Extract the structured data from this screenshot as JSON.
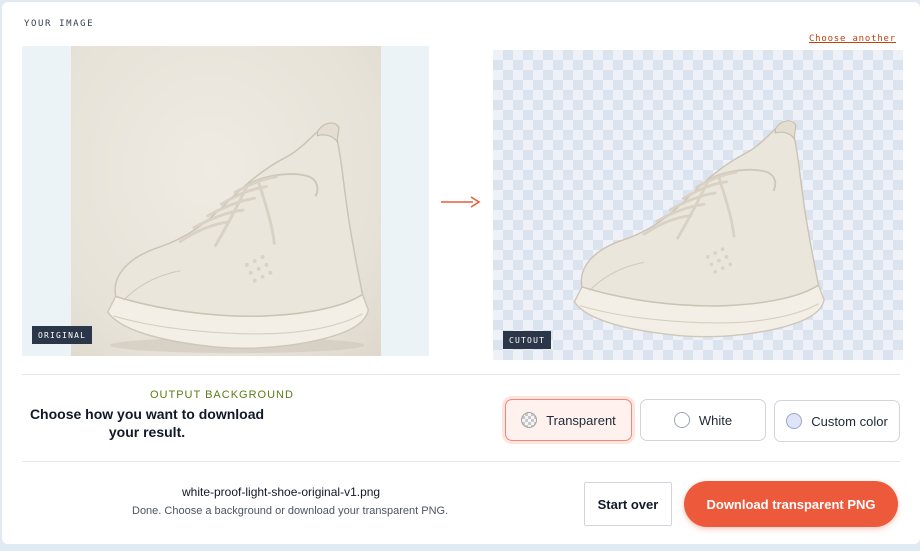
{
  "header": {
    "section_title": "YOUR IMAGE",
    "choose_another": "Choose another"
  },
  "preview": {
    "original_badge": "ORIGINAL",
    "cutout_badge": "CUTOUT",
    "arrow_icon": "arrow-right-icon",
    "accent_color": "#ec5a3b"
  },
  "output": {
    "label": "OUTPUT BACKGROUND",
    "description": "Choose how you want to download your result.",
    "options": [
      {
        "label": "Transparent",
        "selected": true,
        "swatch": "checkerboard"
      },
      {
        "label": "White",
        "selected": false,
        "swatch": "#ffffff"
      },
      {
        "label": "Custom color",
        "selected": false,
        "swatch": "#dfe4f7"
      }
    ]
  },
  "footer": {
    "filename": "white-proof-light-shoe-original-v1.png",
    "status": "Done. Choose a background or download your transparent PNG.",
    "start_over": "Start over",
    "download": "Download transparent PNG"
  }
}
